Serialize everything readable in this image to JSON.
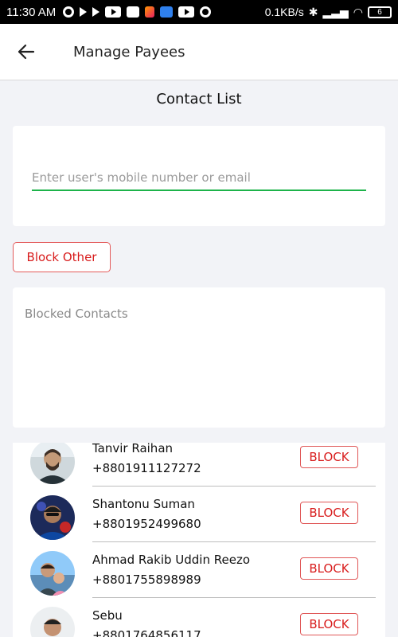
{
  "status_bar": {
    "time": "11:30 AM",
    "network_speed": "0.1KB/s",
    "battery": "6"
  },
  "app_bar": {
    "title": "Manage Payees",
    "back_icon": "arrow-left-icon"
  },
  "contact_list": {
    "title": "Contact List",
    "search": {
      "placeholder": "Enter user's mobile number or email",
      "value": ""
    }
  },
  "block_other_label": "Block Other",
  "blocked_contacts": {
    "label": "Blocked Contacts"
  },
  "contacts": [
    {
      "name": "Tanvir Raihan",
      "phone": "+8801911127272",
      "action": "BLOCK"
    },
    {
      "name": "Shantonu Suman",
      "phone": "+8801952499680",
      "action": "BLOCK"
    },
    {
      "name": "Ahmad Rakib Uddin Reezo",
      "phone": "+8801755898989",
      "action": "BLOCK"
    },
    {
      "name": "Sebu",
      "phone": "+8801764856117",
      "action": "BLOCK"
    }
  ],
  "colors": {
    "accent_red": "#d81c1c",
    "input_underline_green": "#1db34a",
    "background": "#f2f3f7"
  }
}
